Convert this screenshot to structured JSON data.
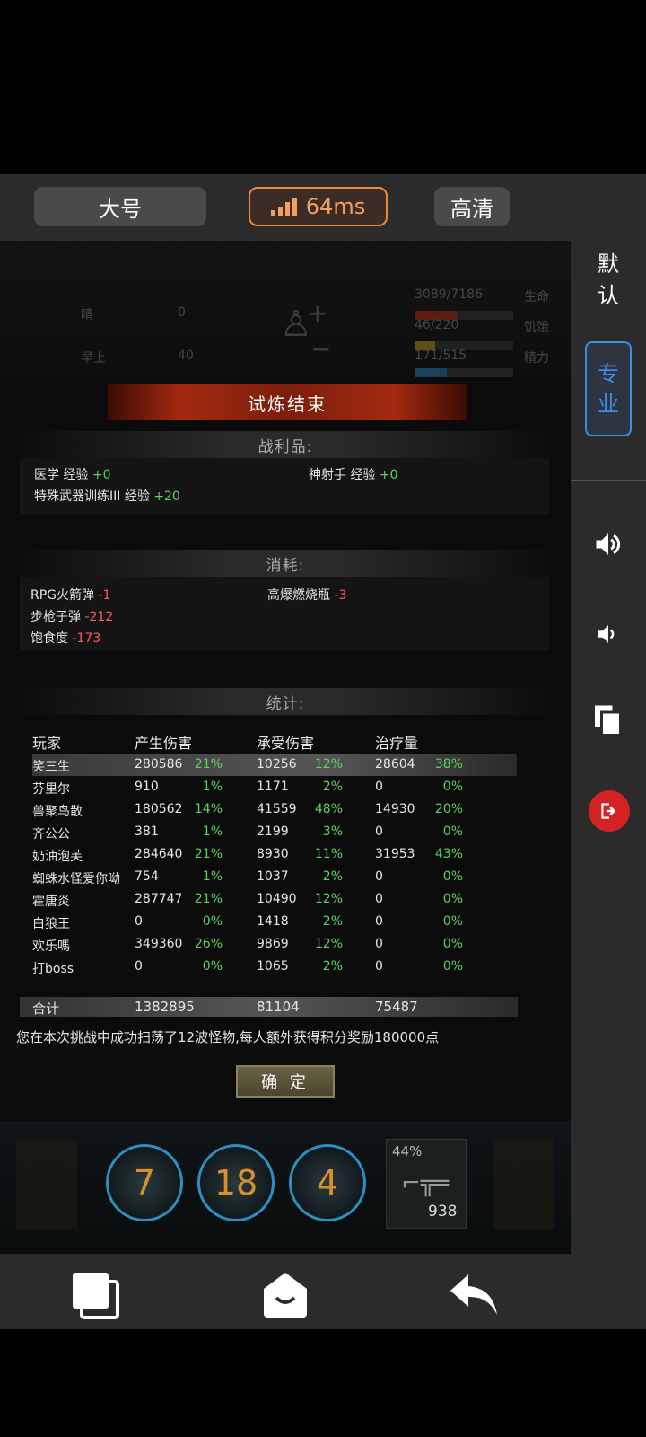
{
  "top_bar": {
    "size_label": "大号",
    "ping_label": "64ms",
    "quality_label": "高清"
  },
  "hud": {
    "weather": "晴",
    "radiation": "0",
    "time_of_day": "早上",
    "temperature": "40",
    "health_text": "3089/7186",
    "health_label": "生命",
    "hunger_text": "46/220",
    "hunger_label": "饥饿",
    "energy_text": "171/515",
    "energy_label": "精力"
  },
  "dialog": {
    "title": "试炼结束",
    "loot_header": "战利品:",
    "loot": [
      {
        "name": "医学 经验",
        "delta": "+0"
      },
      {
        "name": "神射手 经验",
        "delta": "+0"
      },
      {
        "name": "特殊武器训练III 经验",
        "delta": "+20"
      }
    ],
    "consume_header": "消耗:",
    "consumption": [
      {
        "name": "RPG火箭弹",
        "delta": "-1"
      },
      {
        "name": "高爆燃烧瓶",
        "delta": "-3"
      },
      {
        "name": "步枪子弹",
        "delta": "-212"
      },
      {
        "name": "饱食度",
        "delta": "-173"
      }
    ],
    "stats_header": "统计:",
    "columns": [
      "玩家",
      "产生伤害",
      "承受伤害",
      "治疗量"
    ],
    "rows": [
      {
        "player": "笑三生",
        "dmg": "280586",
        "dmg_pct": "21%",
        "taken": "10256",
        "taken_pct": "12%",
        "heal": "28604",
        "heal_pct": "38%"
      },
      {
        "player": "芬里尔",
        "dmg": "910",
        "dmg_pct": "1%",
        "taken": "1171",
        "taken_pct": "2%",
        "heal": "0",
        "heal_pct": "0%"
      },
      {
        "player": "兽聚鸟散",
        "dmg": "180562",
        "dmg_pct": "14%",
        "taken": "41559",
        "taken_pct": "48%",
        "heal": "14930",
        "heal_pct": "20%"
      },
      {
        "player": "齐公公",
        "dmg": "381",
        "dmg_pct": "1%",
        "taken": "2199",
        "taken_pct": "3%",
        "heal": "0",
        "heal_pct": "0%"
      },
      {
        "player": "奶油泡芙",
        "dmg": "284640",
        "dmg_pct": "21%",
        "taken": "8930",
        "taken_pct": "11%",
        "heal": "31953",
        "heal_pct": "43%"
      },
      {
        "player": "蜘蛛水怪爱你呦",
        "dmg": "754",
        "dmg_pct": "1%",
        "taken": "1037",
        "taken_pct": "2%",
        "heal": "0",
        "heal_pct": "0%"
      },
      {
        "player": "霍唐炎",
        "dmg": "287747",
        "dmg_pct": "21%",
        "taken": "10490",
        "taken_pct": "12%",
        "heal": "0",
        "heal_pct": "0%"
      },
      {
        "player": "白狼王",
        "dmg": "0",
        "dmg_pct": "0%",
        "taken": "1418",
        "taken_pct": "2%",
        "heal": "0",
        "heal_pct": "0%"
      },
      {
        "player": "欢乐嗎",
        "dmg": "349360",
        "dmg_pct": "26%",
        "taken": "9869",
        "taken_pct": "12%",
        "heal": "0",
        "heal_pct": "0%"
      },
      {
        "player": "打boss",
        "dmg": "0",
        "dmg_pct": "0%",
        "taken": "1065",
        "taken_pct": "2%",
        "heal": "0",
        "heal_pct": "0%"
      }
    ],
    "total": {
      "label": "合计",
      "dmg": "1382895",
      "taken": "81104",
      "heal": "75487"
    },
    "reward_text": "您在本次挑战中成功扫荡了12波怪物,每人额外获得积分奖励180000点",
    "confirm_label": "确 定"
  },
  "skills": {
    "skill_1": "7",
    "skill_2": "18",
    "skill_3": "4",
    "weapon_pct": "44%",
    "weapon_ammo": "938"
  },
  "sidebar": {
    "default_label_1": "默",
    "default_label_2": "认",
    "pro_label_1": "专",
    "pro_label_2": "业"
  },
  "colors": {
    "accent_orange": "#f08a3a",
    "accent_blue": "#3b8de6",
    "exit_red": "#d32222",
    "positive_green": "#5fd35f",
    "negative_red": "#ff5a5a"
  }
}
